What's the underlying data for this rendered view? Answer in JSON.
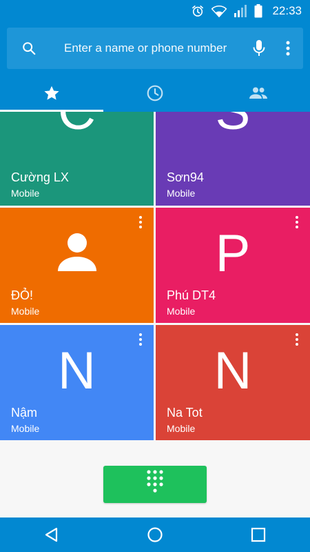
{
  "status_bar": {
    "time": "22:33",
    "icons": [
      "alarm-icon",
      "wifi-icon",
      "signal-icon",
      "battery-icon"
    ]
  },
  "search": {
    "placeholder": "Enter a name or phone number",
    "icons": [
      "search-icon",
      "mic-icon",
      "more-vert-icon"
    ]
  },
  "tabs": [
    {
      "name": "favorites",
      "icon": "star-icon",
      "active": true
    },
    {
      "name": "recents",
      "icon": "clock-icon",
      "active": false
    },
    {
      "name": "contacts",
      "icon": "people-icon",
      "active": false
    }
  ],
  "favorites": [
    {
      "letter": "C",
      "name": "Cường LX",
      "type": "Mobile",
      "color": "#1b967b"
    },
    {
      "letter": "S",
      "name": "Sơn94",
      "type": "Mobile",
      "color": "#693bb5"
    },
    {
      "letter": "",
      "icon": "person-icon",
      "name": "ĐỎ!",
      "type": "Mobile",
      "color": "#ef6c00"
    },
    {
      "letter": "P",
      "name": "Phú DT4",
      "type": "Mobile",
      "color": "#e91e63"
    },
    {
      "letter": "N",
      "name": "Nậm",
      "type": "Mobile",
      "color": "#4287f5"
    },
    {
      "letter": "N",
      "name": "Na Tot",
      "type": "Mobile",
      "color": "#da4337"
    }
  ],
  "dialpad_button": {
    "icon": "dialpad-icon",
    "color": "#1ec15c"
  },
  "nav": {
    "icons": [
      "back-icon",
      "home-icon",
      "recents-icon"
    ]
  },
  "colors": {
    "primary": "#0288d1",
    "search_bg": "#1e96d8"
  }
}
